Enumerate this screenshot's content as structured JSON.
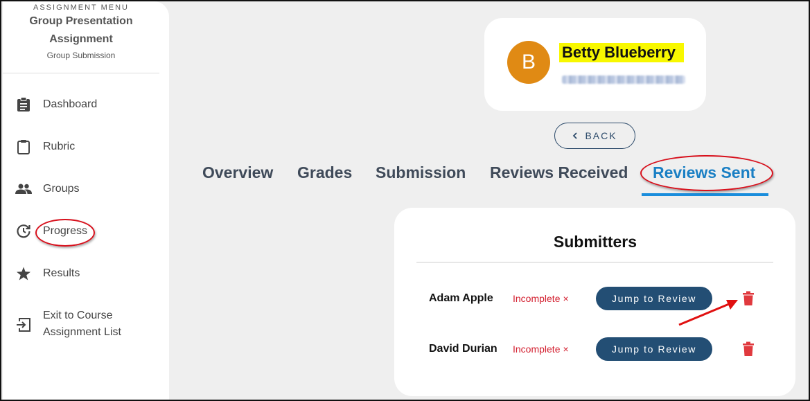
{
  "sidebar": {
    "caption": "ASSIGNMENT MENU",
    "title_line1": "Group Presentation",
    "title_line2": "Assignment",
    "subtitle": "Group Submission",
    "items": [
      {
        "label": "Dashboard",
        "icon": "clipboard-list-icon"
      },
      {
        "label": "Rubric",
        "icon": "clipboard-icon"
      },
      {
        "label": "Groups",
        "icon": "people-icon"
      },
      {
        "label": "Progress",
        "icon": "progress-clock-icon"
      },
      {
        "label": "Results",
        "icon": "star-icon"
      },
      {
        "label_line1": "Exit to Course",
        "label_line2": "Assignment List",
        "icon": "exit-icon"
      }
    ]
  },
  "profile": {
    "initial": "B",
    "name": "Betty Blueberry",
    "avatar_color": "#e08a14",
    "highlight_color": "#f8f800"
  },
  "back_button": {
    "label": "BACK",
    "icon": "chevron-left-icon"
  },
  "tabs": [
    {
      "label": "Overview",
      "active": false
    },
    {
      "label": "Grades",
      "active": false
    },
    {
      "label": "Submission",
      "active": false
    },
    {
      "label": "Reviews Received",
      "active": false
    },
    {
      "label": "Reviews Sent",
      "active": true
    }
  ],
  "submitters": {
    "title": "Submitters",
    "rows": [
      {
        "name": "Adam Apple",
        "status": "Incomplete",
        "status_icon": "×",
        "button": "Jump to Review",
        "delete_icon": "trash-icon"
      },
      {
        "name": "David Durian",
        "status": "Incomplete",
        "status_icon": "×",
        "button": "Jump to Review",
        "delete_icon": "trash-icon"
      }
    ]
  },
  "colors": {
    "accent": "#1a8ddc",
    "button_bg": "#234e74",
    "status_red": "#d32030",
    "annotation_red": "#d8101c"
  }
}
